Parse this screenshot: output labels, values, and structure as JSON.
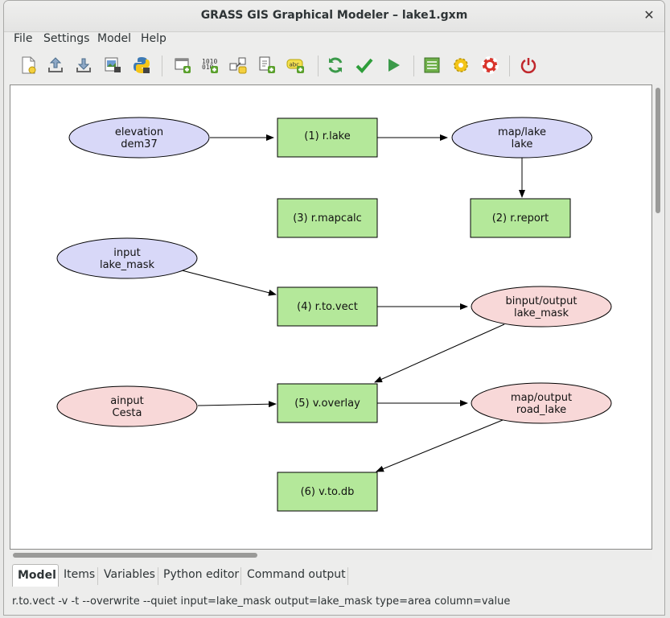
{
  "window": {
    "title": "GRASS GIS Graphical Modeler – lake1.gxm",
    "close_symbol": "✕"
  },
  "menubar": [
    "File",
    "Settings",
    "Model",
    "Help"
  ],
  "toolbar": [
    {
      "icon": "new-model-icon",
      "tooltip": "Create new model"
    },
    {
      "icon": "load-model-icon",
      "tooltip": "Load model from file"
    },
    {
      "icon": "save-model-icon",
      "tooltip": "Save current model to file"
    },
    {
      "icon": "export-image-icon",
      "tooltip": "Export model to image"
    },
    {
      "icon": "export-python-icon",
      "tooltip": "Export model to Python script"
    },
    {
      "icon": "add-command-icon",
      "tooltip": "Add command (GRASS module) to model"
    },
    {
      "icon": "add-data-icon",
      "tooltip": "Add data to model"
    },
    {
      "icon": "add-relation-icon",
      "tooltip": "Manually define relation between data and commands"
    },
    {
      "icon": "add-loop-icon",
      "tooltip": "Add loop/series or if-else statement"
    },
    {
      "icon": "add-comment-icon",
      "tooltip": "Add comment to model"
    },
    {
      "icon": "redraw-icon",
      "tooltip": "Redraw model canvas"
    },
    {
      "icon": "validate-icon",
      "tooltip": "Validate model"
    },
    {
      "icon": "run-icon",
      "tooltip": "Run model"
    },
    {
      "icon": "variables-icon",
      "tooltip": "Show model variables"
    },
    {
      "icon": "settings-icon",
      "tooltip": "Modeler settings"
    },
    {
      "icon": "help-icon",
      "tooltip": "Show manual"
    },
    {
      "icon": "quit-icon",
      "tooltip": "Quit Graphical Modeler"
    }
  ],
  "colors": {
    "data_raster": "#d8d8f8",
    "data_vector": "#f8d8d8",
    "action": "#b4e89a"
  },
  "model": {
    "data": [
      {
        "id": "elevation",
        "line1": "elevation",
        "line2": "dem37",
        "kind": "raster"
      },
      {
        "id": "maplake",
        "line1": "map/lake",
        "line2": "lake",
        "kind": "raster"
      },
      {
        "id": "input",
        "line1": "input",
        "line2": "lake_mask",
        "kind": "raster"
      },
      {
        "id": "binput",
        "line1": "binput/output",
        "line2": "lake_mask",
        "kind": "vector"
      },
      {
        "id": "ainput",
        "line1": "ainput",
        "line2": "Cesta",
        "kind": "vector"
      },
      {
        "id": "mapoutput",
        "line1": "map/output",
        "line2": "road_lake",
        "kind": "vector"
      }
    ],
    "actions": [
      {
        "id": "a1",
        "label": "(1) r.lake"
      },
      {
        "id": "a3",
        "label": "(3) r.mapcalc"
      },
      {
        "id": "a2",
        "label": "(2) r.report"
      },
      {
        "id": "a4",
        "label": "(4) r.to.vect"
      },
      {
        "id": "a5",
        "label": "(5) v.overlay"
      },
      {
        "id": "a6",
        "label": "(6) v.to.db"
      }
    ]
  },
  "tabs": [
    "Model",
    "Items",
    "Variables",
    "Python editor",
    "Command output"
  ],
  "status": "r.to.vect -v -t --overwrite --quiet input=lake_mask output=lake_mask type=area column=value"
}
